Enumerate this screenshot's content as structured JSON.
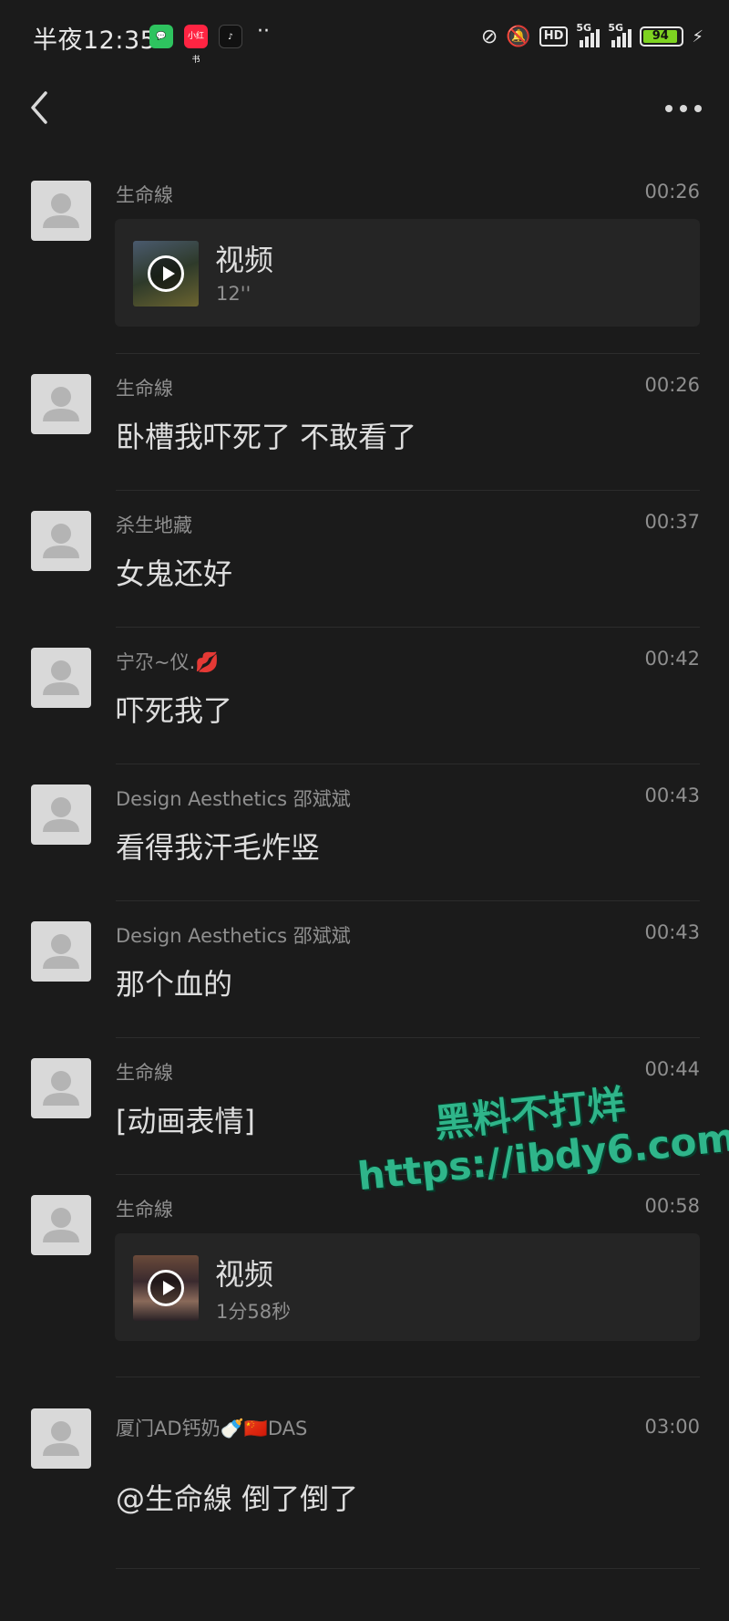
{
  "status_bar": {
    "time": "半夜12:35",
    "apps": [
      "wechat-icon",
      "xiaohongshu-icon",
      "music-icon"
    ],
    "overflow": "··",
    "network": "5G",
    "hd": "HD",
    "battery": "94",
    "colors": {
      "battery": "#7ed321",
      "wechat": "#2ec35f",
      "xiaohongshu": "#ff2442"
    }
  },
  "nav": {
    "back_icon": "chevron-left-icon",
    "more_icon": "more-dots-icon"
  },
  "messages": [
    {
      "sender": "生命線",
      "time": "00:26",
      "video": {
        "title": "视频",
        "duration": "12''"
      }
    },
    {
      "sender": "生命線",
      "time": "00:26",
      "text": "卧槽我吓死了 不敢看了"
    },
    {
      "sender": "杀生地藏",
      "time": "00:37",
      "text": "女鬼还好"
    },
    {
      "sender": "宁尕~仪.💋",
      "time": "00:42",
      "text": "吓死我了"
    },
    {
      "sender": "Design Aesthetics 邵斌斌",
      "time": "00:43",
      "text": "看得我汗毛炸竖"
    },
    {
      "sender": "Design Aesthetics 邵斌斌",
      "time": "00:43",
      "text": "那个血的"
    },
    {
      "sender": "生命線",
      "time": "00:44",
      "text": "[动画表情]"
    },
    {
      "sender": "生命線",
      "time": "00:58",
      "video": {
        "title": "视频",
        "duration": "1分58秒"
      }
    },
    {
      "sender": "厦门AD钙奶🍼🇨🇳DAS",
      "time": "03:00",
      "text": "@生命線 倒了倒了"
    }
  ],
  "watermark": {
    "line1": "黑料不打烊",
    "line2": "https://ibdy6.com"
  }
}
